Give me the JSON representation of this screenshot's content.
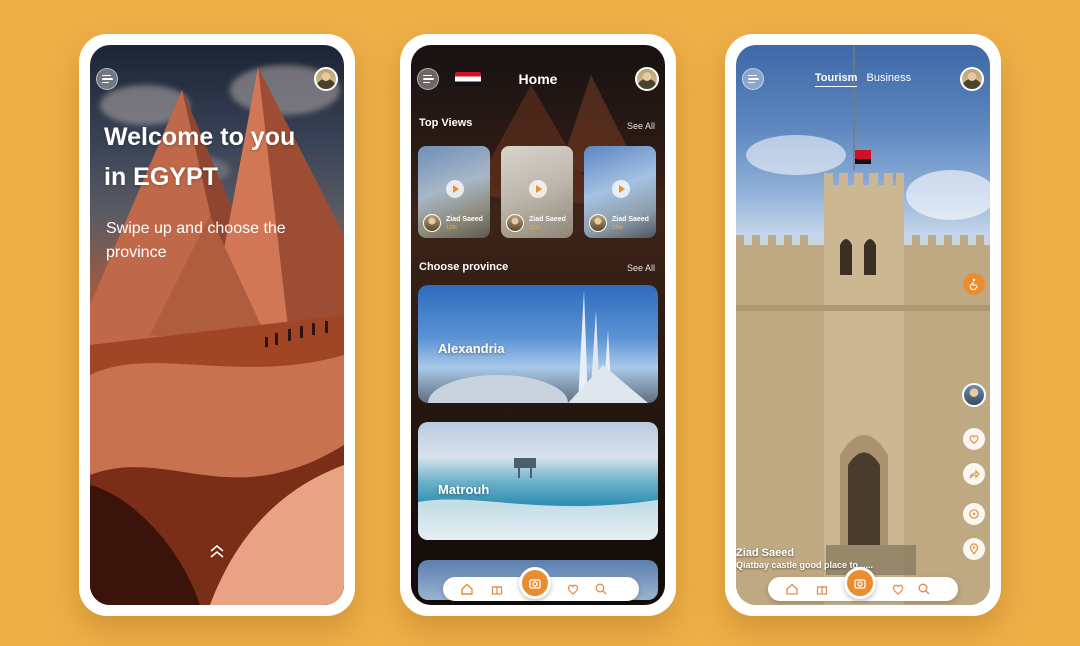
{
  "colors": {
    "background": "#efaf47",
    "accent": "#ea8d2f",
    "card_white": "#ffffff"
  },
  "welcome_screen": {
    "title": "Welcome to you in EGYPT",
    "subtitle": "Swipe up and choose the province",
    "icons": [
      "menu-icon",
      "avatar",
      "chevron-up-icon"
    ]
  },
  "home_screen": {
    "title": "Home",
    "flag": "egypt-flag",
    "top_views": {
      "title": "Top Views",
      "see_all": "See All",
      "videos": [
        {
          "author": "Ziad Saeed",
          "views": "120k"
        },
        {
          "author": "Ziad Saeed",
          "views": "120k"
        },
        {
          "author": "Ziad Saeed",
          "views": "120k"
        }
      ]
    },
    "provinces": {
      "title": "Choose province",
      "see_all": "See All",
      "items": [
        {
          "name": "Alexandria"
        },
        {
          "name": "Matrouh"
        }
      ]
    }
  },
  "detail_screen": {
    "tabs": [
      {
        "label": "Tourism",
        "active": true
      },
      {
        "label": "Business",
        "active": false
      }
    ],
    "author": "Ziad Saeed",
    "caption": "Qiatbay castle good place to......",
    "side_actions": [
      "accessibility-icon",
      "avatar",
      "heart-icon",
      "share-icon",
      "comment-icon",
      "location-icon"
    ]
  },
  "bottom_nav": {
    "items": [
      "home-icon",
      "gift-icon",
      "camera-icon",
      "heart-icon",
      "search-icon"
    ]
  }
}
